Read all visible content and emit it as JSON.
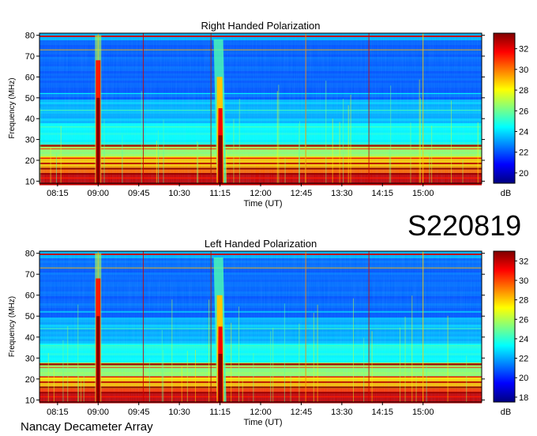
{
  "chart_data": [
    {
      "type": "heatmap",
      "title": "Right Handed Polarization",
      "xlabel": "Time (UT)",
      "ylabel": "Frequency (MHz)",
      "x_ticks": [
        "08:15",
        "09:00",
        "09:45",
        "10:30",
        "11:15",
        "12:00",
        "12:45",
        "13:30",
        "14:15",
        "15:00"
      ],
      "y_ticks": [
        10,
        20,
        30,
        40,
        50,
        60,
        70,
        80
      ],
      "ylim": [
        9,
        81
      ],
      "colorbar": {
        "label": "dB",
        "ticks": [
          20,
          22,
          24,
          26,
          28,
          30,
          32
        ],
        "range": [
          19,
          33.5
        ]
      },
      "burst_times": [
        "09:00",
        "11:15"
      ]
    },
    {
      "type": "heatmap",
      "title": "Left Handed Polarization",
      "xlabel": "Time (UT)",
      "ylabel": "Frequency (MHz)",
      "x_ticks": [
        "08:15",
        "09:00",
        "09:45",
        "10:30",
        "11:15",
        "12:00",
        "12:45",
        "13:30",
        "14:15",
        "15:00"
      ],
      "y_ticks": [
        10,
        20,
        30,
        40,
        50,
        60,
        70,
        80
      ],
      "ylim": [
        9,
        81
      ],
      "colorbar": {
        "label": "dB",
        "ticks": [
          18,
          20,
          22,
          24,
          26,
          28,
          30,
          32
        ],
        "range": [
          17.5,
          33
        ]
      },
      "burst_times": [
        "09:00",
        "11:15"
      ]
    }
  ],
  "observation_id": "S220819",
  "instrument": "Nancay Decameter Array"
}
